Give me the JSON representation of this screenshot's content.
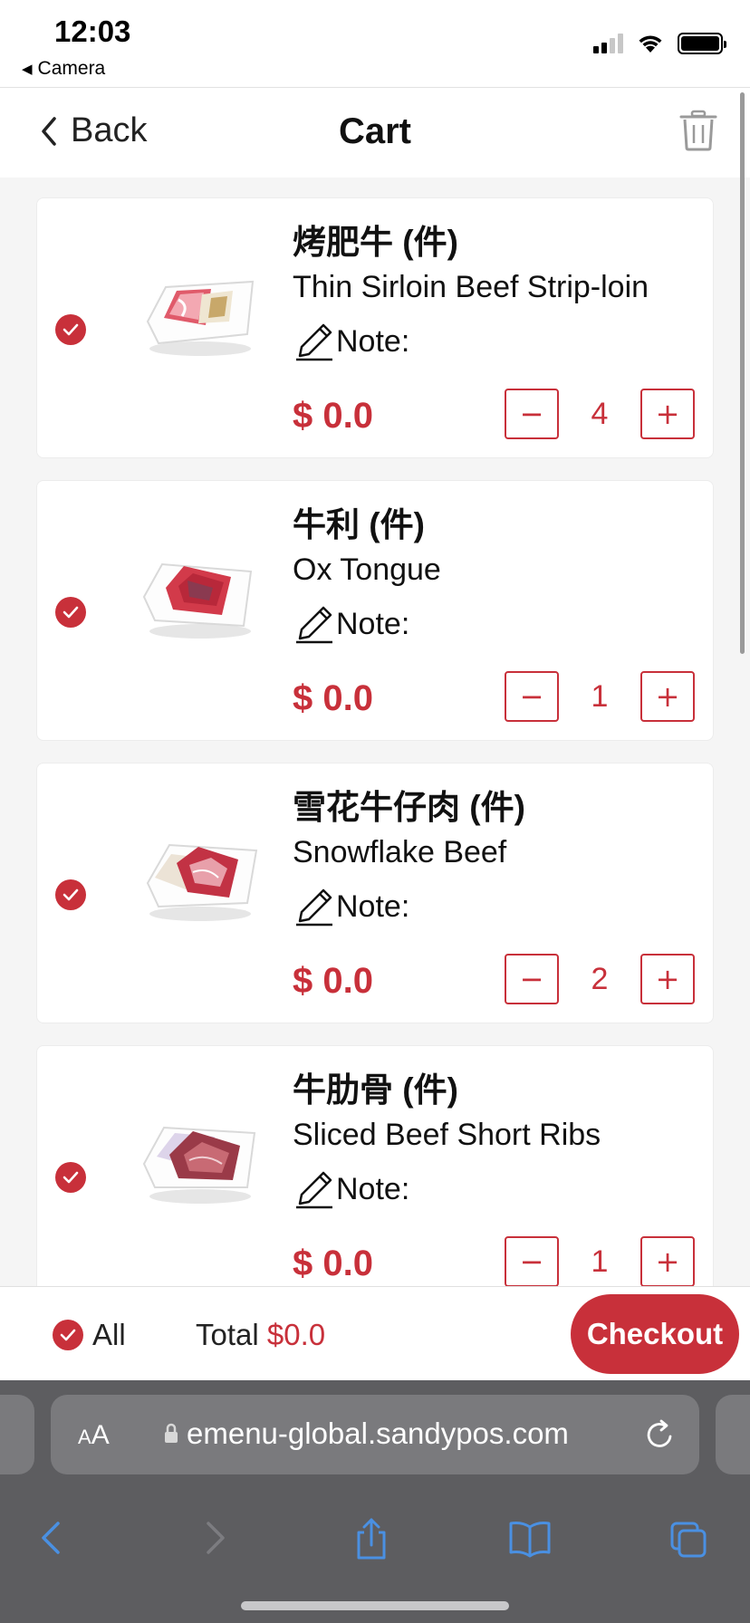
{
  "status_bar": {
    "time": "12:03",
    "back_app": "Camera"
  },
  "nav": {
    "back_label": "Back",
    "title": "Cart"
  },
  "items": [
    {
      "name_cn": "烤肥牛 (件)",
      "name_en": "Thin Sirloin Beef Strip-loin",
      "note_label": "Note:",
      "price": "$ 0.0",
      "quantity": "4",
      "minus": "−",
      "plus": "+"
    },
    {
      "name_cn": "牛利 (件)",
      "name_en": "Ox Tongue",
      "note_label": "Note:",
      "price": "$ 0.0",
      "quantity": "1",
      "minus": "−",
      "plus": "+"
    },
    {
      "name_cn": "雪花牛仔肉 (件)",
      "name_en": "Snowflake Beef",
      "note_label": "Note:",
      "price": "$ 0.0",
      "quantity": "2",
      "minus": "−",
      "plus": "+"
    },
    {
      "name_cn": "牛肋骨 (件)",
      "name_en": "Sliced Beef Short Ribs",
      "note_label": "Note:",
      "price": "$ 0.0",
      "quantity": "1",
      "minus": "−",
      "plus": "+"
    }
  ],
  "footer": {
    "select_all_label": "All",
    "total_label": "Total",
    "total_amount": "$0.0",
    "checkout_label": "Checkout"
  },
  "browser": {
    "text_size_big": "A",
    "text_size_small": "A",
    "url": "emenu-global.sandypos.com"
  },
  "colors": {
    "accent": "#c8303a",
    "browser_bg": "#5d5d60",
    "browser_icon": "#4a90e2"
  },
  "icons": [
    "back-chevron-icon",
    "trash-icon",
    "checkmark-icon",
    "pencil-icon",
    "lock-icon",
    "reload-icon",
    "share-icon",
    "bookmarks-icon",
    "tabs-icon"
  ]
}
